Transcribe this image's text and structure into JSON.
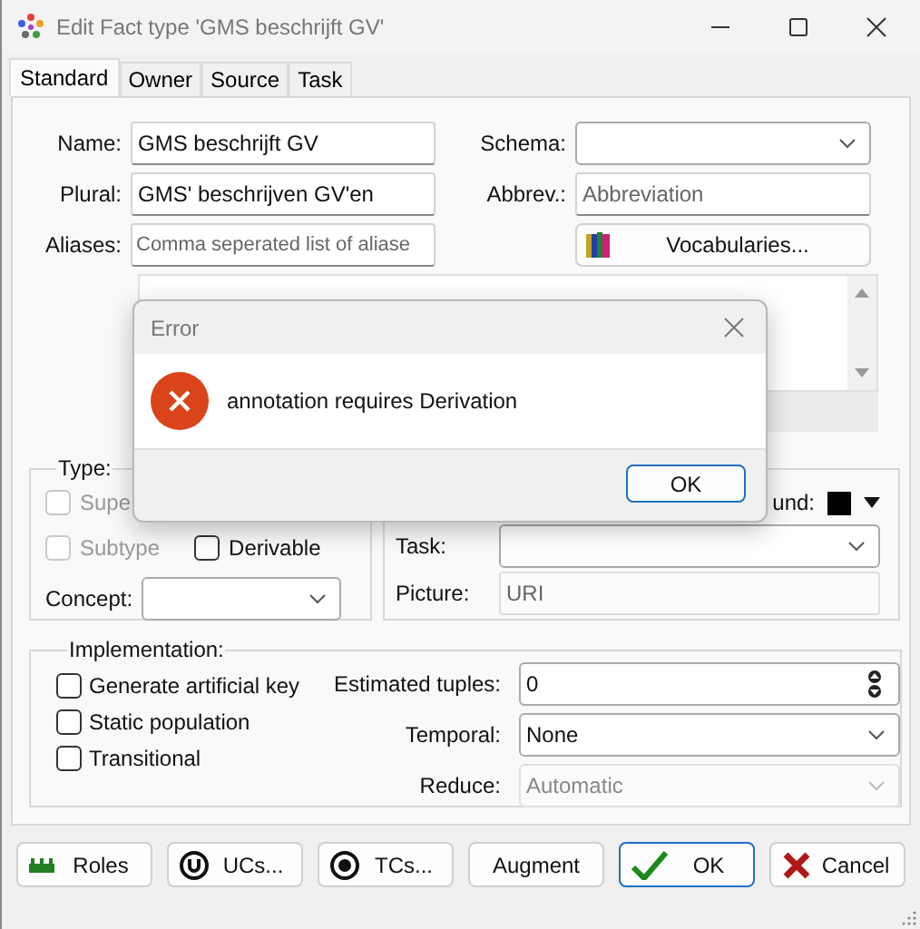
{
  "window": {
    "title": "Edit Fact type 'GMS beschrijft GV'"
  },
  "tabs": [
    {
      "label": "Standard",
      "selected": true
    },
    {
      "label": "Owner",
      "selected": false
    },
    {
      "label": "Source",
      "selected": false
    },
    {
      "label": "Task",
      "selected": false
    }
  ],
  "general": {
    "name_label": "Name:",
    "name": "GMS beschrijft GV",
    "plural_label": "Plural:",
    "plural": "GMS' beschrijven GV'en",
    "aliases_label": "Aliases:",
    "aliases_placeholder": "Comma seperated list of aliase",
    "schema_label": "Schema:",
    "abbrev_label": "Abbrev.:",
    "abbrev_placeholder": "Abbreviation",
    "vocab_button": "Vocabularies..."
  },
  "type_group": {
    "label": "Type:",
    "checkboxes": [
      {
        "label": "Supe",
        "checked": false,
        "disabled": true
      },
      {
        "label": "Subtype",
        "checked": false,
        "disabled": true
      },
      {
        "label": "Derivable",
        "checked": false,
        "disabled": false
      }
    ],
    "concept_label": "Concept:"
  },
  "appearance_group": {
    "background_label": "und:",
    "task_label": "Task:",
    "picture_label": "Picture:",
    "picture_placeholder": "URI"
  },
  "implementation": {
    "label": "Implementation:",
    "checkboxes": [
      {
        "label": "Generate artificial key",
        "checked": false
      },
      {
        "label": "Static population",
        "checked": false
      },
      {
        "label": "Transitional",
        "checked": false
      }
    ],
    "tuples_label": "Estimated tuples:",
    "tuples": "0",
    "temporal_label": "Temporal:",
    "temporal": "None",
    "reduce_label": "Reduce:",
    "reduce": "Automatic"
  },
  "buttons": [
    {
      "label": "Roles",
      "kind": "roles",
      "default": false
    },
    {
      "label": "UCs...",
      "kind": "uc",
      "default": false
    },
    {
      "label": "TCs...",
      "kind": "tc",
      "default": false
    },
    {
      "label": "Augment",
      "kind": "plain",
      "default": false
    },
    {
      "label": "OK",
      "kind": "ok",
      "default": true
    },
    {
      "label": "Cancel",
      "kind": "cancel",
      "default": false
    }
  ],
  "error_dialog": {
    "title": "Error",
    "message": "annotation requires Derivation",
    "button": "OK"
  }
}
